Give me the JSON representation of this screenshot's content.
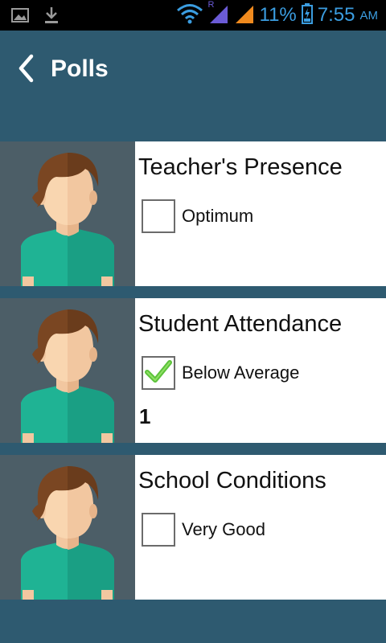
{
  "status_bar": {
    "battery_percent": "11%",
    "time": "7:55",
    "ampm": "AM",
    "roaming": "R",
    "icons": [
      "image-icon",
      "download-icon",
      "wifi-icon",
      "signal-icon",
      "signal-icon",
      "battery-icon"
    ],
    "accent_color": "#3b9de0"
  },
  "header": {
    "title": "Polls",
    "back_icon": "chevron-left-icon",
    "background": "#2e5a70"
  },
  "polls": [
    {
      "question": "Teacher's Presence",
      "option_label": "Optimum",
      "checked": false,
      "vote_count": ""
    },
    {
      "question": "Student Attendance",
      "option_label": "Below Average",
      "checked": true,
      "vote_count": "1"
    },
    {
      "question": "School Conditions",
      "option_label": "Very Good",
      "checked": false,
      "vote_count": ""
    }
  ]
}
